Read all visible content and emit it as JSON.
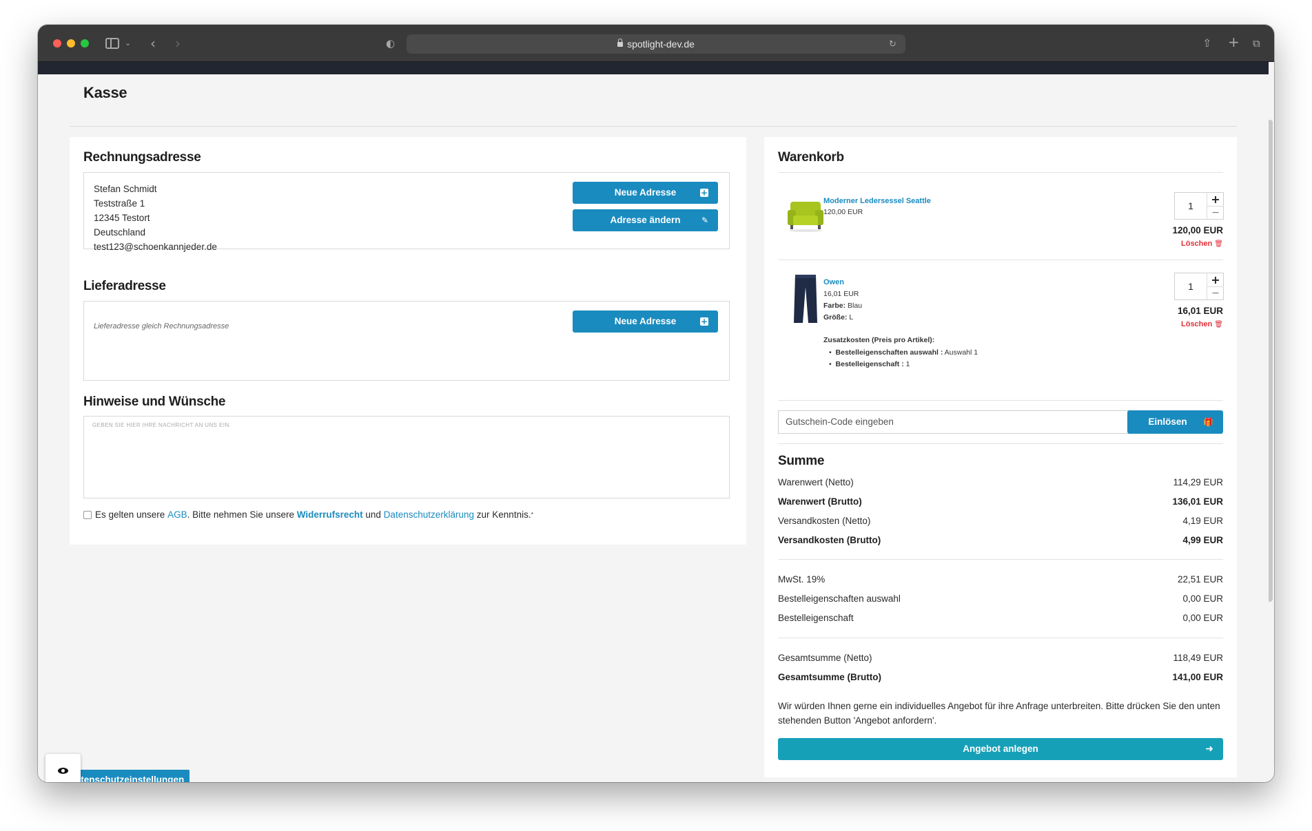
{
  "browser": {
    "url": "spotlight-dev.de"
  },
  "page": {
    "title": "Kasse"
  },
  "billing": {
    "heading": "Rechnungsadresse",
    "lines": [
      "Stefan Schmidt",
      "Teststraße 1",
      "12345 Testort",
      "Deutschland",
      "test123@schoenkannjeder.de"
    ],
    "new_address_label": "Neue Adresse",
    "change_address_label": "Adresse ändern"
  },
  "shipping": {
    "heading": "Lieferadresse",
    "note": "Lieferadresse gleich Rechnungsadresse",
    "new_address_label": "Neue Adresse"
  },
  "notes": {
    "heading": "Hinweise und Wünsche",
    "placeholder": "GEBEN SIE HIER IHRE NACHRICHT AN UNS EIN."
  },
  "terms": {
    "prefix": "Es gelten unsere",
    "agb": "AGB",
    "middle": ". Bitte nehmen Sie unsere",
    "withdrawal": "Widerrufsrecht",
    "and": "und",
    "privacy": "Datenschutzerklärung",
    "suffix": "zur Kenntnis.",
    "asterisk": "*"
  },
  "cart": {
    "heading": "Warenkorb",
    "items": [
      {
        "name": "Moderner Ledersessel Seattle",
        "unit_price": "120,00 EUR",
        "quantity": "1",
        "line_total": "120,00 EUR",
        "delete_label": "Löschen"
      },
      {
        "name": "Owen",
        "unit_price": "16,01 EUR",
        "color_label": "Farbe:",
        "color_value": "Blau",
        "size_label": "Größe:",
        "size_value": "L",
        "extras_title": "Zusatzkosten (Preis pro Artikel):",
        "extras": [
          {
            "label": "Bestelleigenschaften auswahl :",
            "value": "Auswahl 1"
          },
          {
            "label": "Bestelleigenschaft :",
            "value": "1"
          }
        ],
        "quantity": "1",
        "line_total": "16,01 EUR",
        "delete_label": "Löschen"
      }
    ],
    "voucher_placeholder": "Gutschein-Code eingeben",
    "voucher_button": "Einlösen"
  },
  "summary": {
    "heading": "Summe",
    "rows1": [
      {
        "label": "Warenwert (Netto)",
        "value": "114,29 EUR"
      },
      {
        "label": "Warenwert (Brutto)",
        "value": "136,01 EUR"
      },
      {
        "label": "Versandkosten (Netto)",
        "value": "4,19 EUR"
      },
      {
        "label": "Versandkosten (Brutto)",
        "value": "4,99 EUR"
      }
    ],
    "rows2": [
      {
        "label": "MwSt. 19%",
        "value": "22,51 EUR"
      },
      {
        "label": "Bestelleigenschaften auswahl",
        "value": "0,00 EUR"
      },
      {
        "label": "Bestelleigenschaft",
        "value": "0,00 EUR"
      }
    ],
    "rows3": [
      {
        "label": "Gesamtsumme (Netto)",
        "value": "118,49 EUR"
      },
      {
        "label": "Gesamtsumme (Brutto)",
        "value": "141,00 EUR"
      }
    ],
    "info": "Wir würden Ihnen gerne ein individuelles Angebot für ihre Anfrage unterbreiten. Bitte drücken Sie den unten stehenden Button 'Angebot anfordern'.",
    "submit_label": "Angebot anlegen"
  },
  "privacy_settings": {
    "label": "Datenschutzeinstellungen"
  },
  "colors": {
    "accent": "#1a8bbf",
    "submit": "#16a0b8",
    "delete": "#e0303a"
  }
}
